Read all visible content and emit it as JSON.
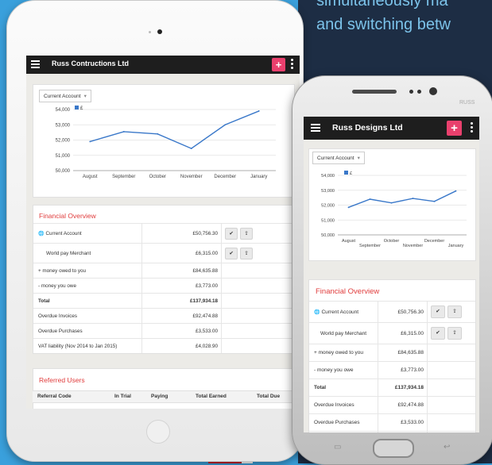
{
  "tagline": {
    "line1": "simultaneously ma",
    "line2": "and switching betw"
  },
  "phone_brand": "RUSS",
  "tablet": {
    "app_title": "Russ Contructions Ltd",
    "plus_label": "+",
    "account_select": "Current Account",
    "financial_title": "Financial Overview",
    "referred_title": "Referred Users",
    "referred_columns": [
      "Referral Code",
      "In Trial",
      "Paying",
      "Total Earned",
      "Total Due"
    ]
  },
  "phone": {
    "app_title": "Russ Designs Ltd",
    "plus_label": "+",
    "account_select": "Current Account",
    "financial_title": "Financial Overview"
  },
  "financial_rows": [
    {
      "label": "Current Account",
      "amount": "£50,756.30",
      "actions": true,
      "icon": "globe-icon"
    },
    {
      "label": "World pay Merchant",
      "amount": "£6,315.00",
      "actions": true,
      "indent": true
    },
    {
      "label": "+ money owed to you",
      "amount": "£84,635.88"
    },
    {
      "label": "- money you owe",
      "amount": "£3,773.00"
    },
    {
      "label": "Total",
      "amount": "£137,934.18",
      "bold": true
    },
    {
      "label": "Overdue Invoices",
      "amount": "£92,474.88"
    },
    {
      "label": "Overdue Purchases",
      "amount": "£3,533.00"
    },
    {
      "label": "VAT liability (Nov 2014 to Jan 2015)",
      "amount": "£4,028.90"
    }
  ],
  "action_icons": {
    "check": "✔",
    "export": "⇪"
  },
  "chart_data": {
    "type": "line",
    "categories": [
      "August",
      "September",
      "October",
      "November",
      "December",
      "January"
    ],
    "series": [
      {
        "name": "£",
        "values": [
          51900,
          52550,
          52400,
          51450,
          53000,
          53900
        ]
      }
    ],
    "ylim": [
      50000,
      54000
    ],
    "yticks": [
      50000,
      51000,
      52000,
      53000,
      54000
    ],
    "ytick_labels": [
      "50,000",
      "51,000",
      "52,000",
      "53,000",
      "54,000"
    ],
    "legend_position": "top-left",
    "color": "#3a78c9",
    "grid": true
  },
  "phone_chart_data": {
    "type": "line",
    "categories": [
      "August",
      "September",
      "October",
      "November",
      "December",
      "January"
    ],
    "series": [
      {
        "name": "£",
        "values": [
          51850,
          52400,
          52150,
          52450,
          52250,
          52950
        ]
      }
    ],
    "ylim": [
      50000,
      54000
    ],
    "yticks": [
      50000,
      51000,
      52000,
      53000,
      54000
    ],
    "ytick_labels": [
      "50,000",
      "51,000",
      "52,000",
      "53,000",
      "54,000"
    ],
    "legend_position": "top-left",
    "color": "#3a78c9",
    "grid": true
  },
  "colors": {
    "brand_pink": "#e9406d",
    "title_red": "#e03c3c",
    "background_blue": "#3aa0dc",
    "navy": "#1d2d44"
  }
}
